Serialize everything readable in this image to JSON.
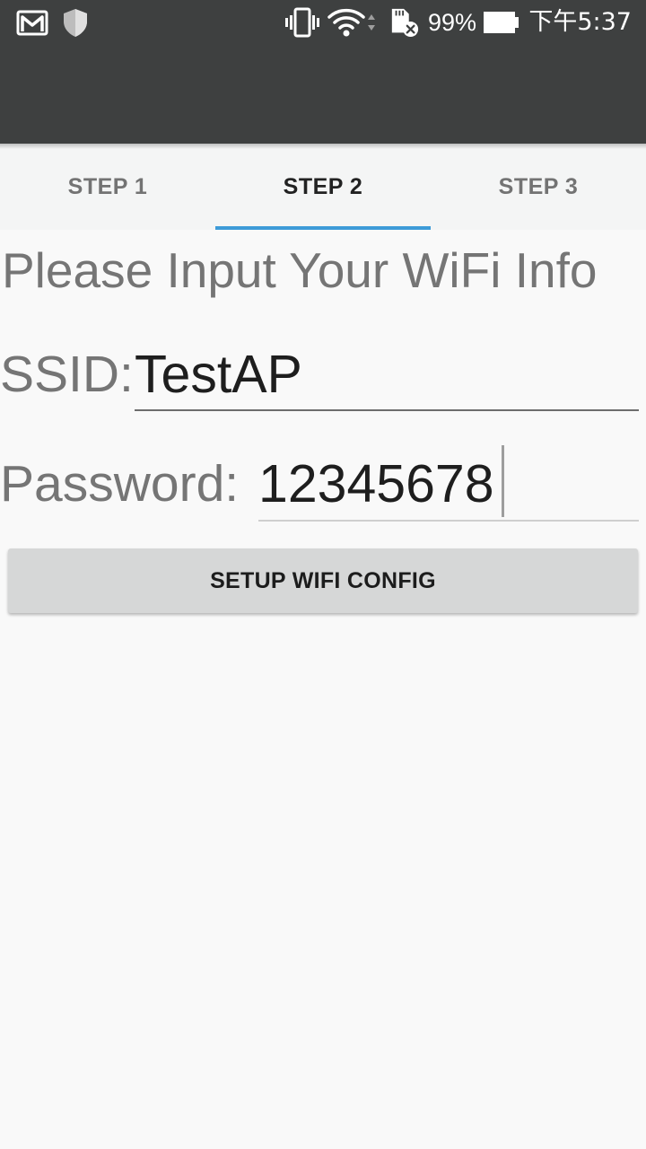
{
  "status_bar": {
    "battery_percent": "99%",
    "time": "下午5:37",
    "icons": [
      "gmail-icon",
      "shield-icon",
      "vibrate-icon",
      "wifi-icon",
      "sd-card-error-icon",
      "battery-icon"
    ]
  },
  "tabs": [
    {
      "label": "STEP 1",
      "active": false
    },
    {
      "label": "STEP 2",
      "active": true
    },
    {
      "label": "STEP 3",
      "active": false
    }
  ],
  "form": {
    "heading": "Please Input Your WiFi Info",
    "ssid_label": "SSID:",
    "ssid_value": "TestAP",
    "password_label": "Password:",
    "password_value": "12345678",
    "submit_label": "SETUP WIFI CONFIG"
  },
  "colors": {
    "top_bar": "#3e4040",
    "tab_indicator": "#3d9bd8",
    "background": "#f9f9f9",
    "button": "#d6d7d7"
  }
}
